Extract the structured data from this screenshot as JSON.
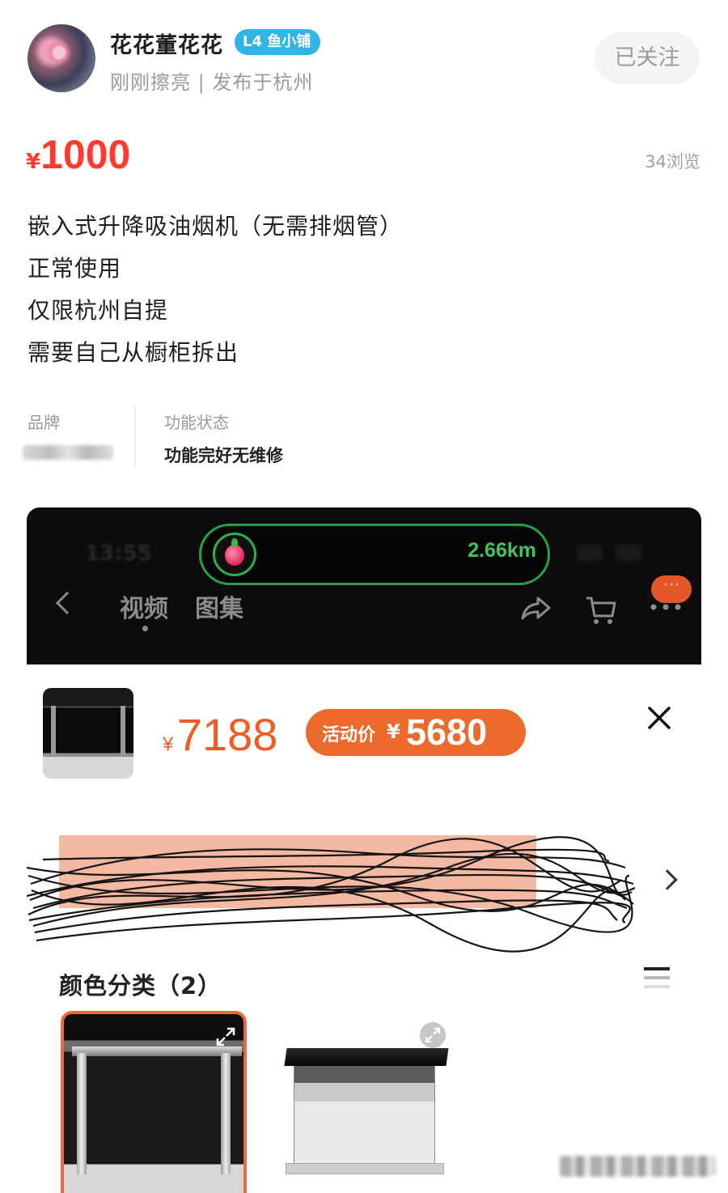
{
  "seller": {
    "name": "花花董花花",
    "badge_level": "L4",
    "badge_text": "鱼小铺",
    "subline": "刚刚擦亮 | 发布于杭州",
    "follow_label": "已关注"
  },
  "listing": {
    "currency": "¥",
    "price": "1000",
    "views": "34浏览",
    "description": [
      "嵌入式升降吸油烟机（无需排烟管）",
      "正常使用",
      "仅限杭州自提",
      "需要自己从橱柜拆出"
    ],
    "attributes": {
      "brand_label": "品牌",
      "function_label": "功能状态",
      "function_value": "功能完好无维修"
    }
  },
  "screenshot": {
    "distance": "2.66km",
    "tabs": [
      "视频",
      "图集"
    ],
    "more_badge": "···",
    "original_currency": "¥",
    "original_price": "7188",
    "promo_label": "活动价",
    "promo_currency": "¥",
    "promo_price": "5680",
    "color_section_title": "颜色分类（2）"
  },
  "colors": {
    "price_red": "#ff3b30",
    "promo_orange": "#ec6a2c",
    "badge_blue": "#2fb6e6",
    "distance_green": "#41c45f"
  }
}
